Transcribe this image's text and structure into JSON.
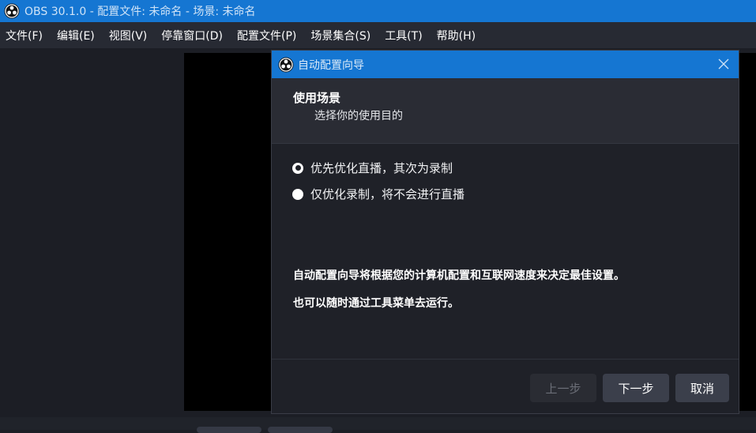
{
  "window": {
    "title": "OBS 30.1.0 - 配置文件: 未命名 - 场景: 未命名"
  },
  "menu": [
    "文件(F)",
    "编辑(E)",
    "视图(V)",
    "停靠窗口(D)",
    "配置文件(P)",
    "场景集合(S)",
    "工具(T)",
    "帮助(H)"
  ],
  "dialog": {
    "title": "自动配置向导",
    "heading": "使用场景",
    "subheading": "选择你的使用目的",
    "options": [
      {
        "label": "优先优化直播，其次为录制",
        "selected": true
      },
      {
        "label": "仅优化录制，将不会进行直播",
        "selected": false
      }
    ],
    "info_line1": "自动配置向导将根据您的计算机配置和互联网速度来决定最佳设置。",
    "info_line2": "也可以随时通过工具菜单去运行。",
    "buttons": {
      "back": "上一步",
      "next": "下一步",
      "cancel": "取消"
    }
  },
  "icons": {
    "app": "obs-logo-icon",
    "close": "close-icon"
  },
  "colors": {
    "accent": "#1576d2",
    "background": "#1c1e25",
    "dialog_bg": "#1f2128"
  }
}
